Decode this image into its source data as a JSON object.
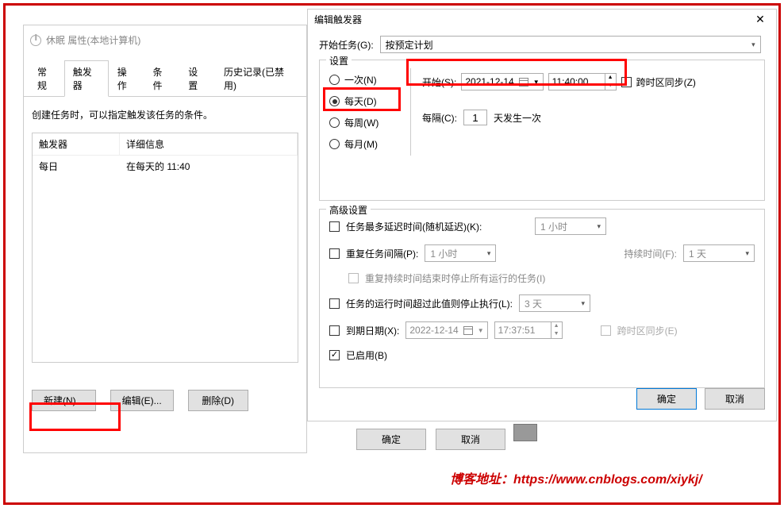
{
  "left": {
    "title": "休眠 属性(本地计算机)",
    "tabs": [
      "常规",
      "触发器",
      "操作",
      "条件",
      "设置",
      "历史记录(已禁用)"
    ],
    "active_tab": 1,
    "desc": "创建任务时，可以指定触发该任务的条件。",
    "list_headers": [
      "触发器",
      "详细信息"
    ],
    "list_rows": [
      {
        "trigger": "每日",
        "detail": "在每天的 11:40"
      }
    ],
    "buttons": {
      "new": "新建(N)...",
      "edit": "编辑(E)...",
      "delete": "删除(D)"
    }
  },
  "right": {
    "title": "编辑触发器",
    "start_task_label": "开始任务(G):",
    "start_task_value": "按预定计划",
    "settings_label": "设置",
    "radios": {
      "once": "一次(N)",
      "daily": "每天(D)",
      "weekly": "每周(W)",
      "monthly": "每月(M)"
    },
    "radio_checked": "daily",
    "start_label": "开始(S):",
    "start_date": "2021-12-14",
    "start_time": "11:40:00",
    "sync_tz": "跨时区同步(Z)",
    "interval_label": "每隔(C):",
    "interval_value": "1",
    "interval_suffix": "天发生一次",
    "adv_label": "高级设置",
    "adv": {
      "delay_label": "任务最多延迟时间(随机延迟)(K):",
      "delay_value": "1 小时",
      "repeat_label": "重复任务间隔(P):",
      "repeat_value": "1 小时",
      "duration_label": "持续时间(F):",
      "duration_value": "1 天",
      "repeat_stop": "重复持续时间结束时停止所有运行的任务(I)",
      "stop_label": "任务的运行时间超过此值则停止执行(L):",
      "stop_value": "3 天",
      "expire_label": "到期日期(X):",
      "expire_date": "2022-12-14",
      "expire_time": "17:37:51",
      "expire_sync": "跨时区同步(E)",
      "enabled_label": "已启用(B)"
    },
    "ok": "确定",
    "cancel": "取消"
  },
  "bottom": {
    "ok": "确定",
    "cancel": "取消"
  },
  "blog": "博客地址：https://www.cnblogs.com/xiykj/"
}
